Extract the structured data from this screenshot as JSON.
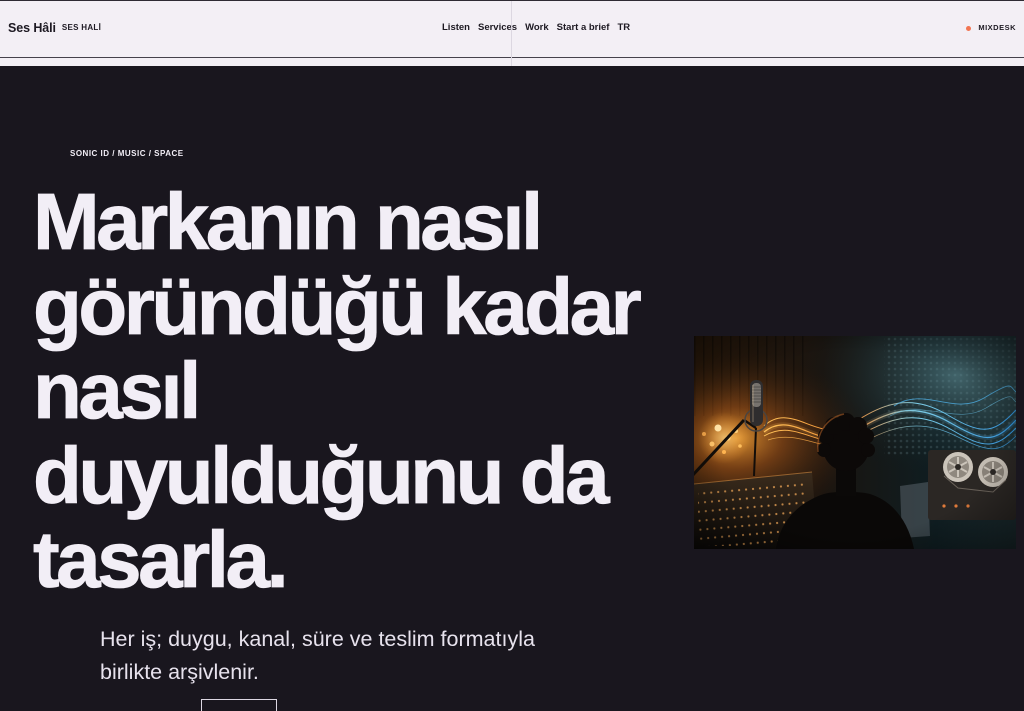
{
  "header": {
    "brand": "Ses Hâli",
    "brand_sub": "SES HALİ",
    "nav": [
      {
        "label": "Listen"
      },
      {
        "label": "Services"
      },
      {
        "label": "Work"
      },
      {
        "label": "Start a brief"
      },
      {
        "label": "TR"
      }
    ],
    "status": {
      "label": "MIXDESK",
      "icon": "status-dot-icon"
    }
  },
  "hero": {
    "eyebrow": "SONIC ID / MUSIC / SPACE",
    "title_lines": [
      "Markanın nasıl",
      "göründüğü kadar",
      "nasıl",
      "duyulduğunu da",
      "tasarla."
    ],
    "subtitle": "Her iş; duygu, kanal, süre ve teslim formatıyla birlikte arşivlenir."
  },
  "colors": {
    "header_bg": "#f3eff5",
    "hero_bg": "#19161e",
    "text_dark": "#1d1922",
    "text_light": "#f2eef6",
    "accent": "#f27552"
  }
}
